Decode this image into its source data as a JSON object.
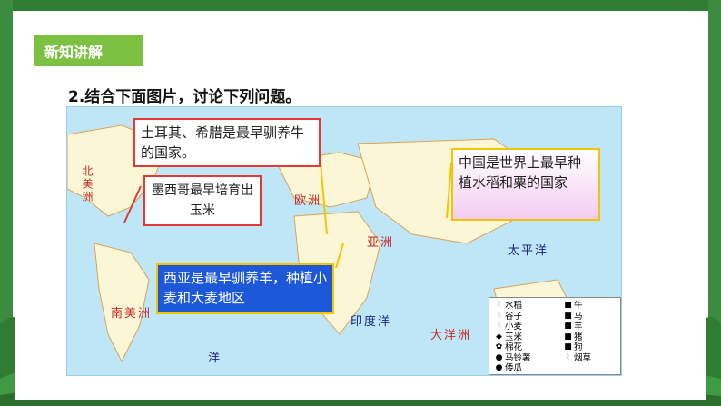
{
  "section_tag": "新知讲解",
  "question": "2.结合下面图片，讨论下列问题。",
  "continents": {
    "north_america": "北美洲",
    "europe": "欧洲",
    "asia": "亚洲",
    "south_america": "南美洲",
    "pacific": "太平洋",
    "indian": "印度洋",
    "oceania": "大洋洲",
    "bottom": "洋"
  },
  "callouts": {
    "turkey": "土耳其、希腊是最早驯养牛的国家。",
    "mexico": "墨西哥最早培育出玉米",
    "china": "中国是世界上最早种植水稻和粟的国家",
    "westasia": "西亚是最早驯养羊，种植小麦和大麦地区"
  },
  "legend": {
    "left": [
      {
        "icon": "rice-icon",
        "label": "水稻"
      },
      {
        "icon": "millet-icon",
        "label": "谷子"
      },
      {
        "icon": "wheat-icon",
        "label": "小麦"
      },
      {
        "icon": "corn-icon",
        "label": "玉米"
      },
      {
        "icon": "cotton-icon",
        "label": "棉花"
      },
      {
        "icon": "potato-icon",
        "label": "马铃薯"
      },
      {
        "icon": "sweet-potato-icon",
        "label": "倭瓜"
      }
    ],
    "right": [
      {
        "icon": "cattle-icon",
        "label": "牛"
      },
      {
        "icon": "horse-icon",
        "label": "马"
      },
      {
        "icon": "sheep-icon",
        "label": "羊"
      },
      {
        "icon": "pig-icon",
        "label": "猪"
      },
      {
        "icon": "dog-icon",
        "label": "狗"
      },
      {
        "icon": "tobacco-icon",
        "label": "烟草"
      }
    ]
  },
  "colors": {
    "ocean": "#bfe6f7",
    "land": "#fbf7d6",
    "tag_green": "#7cc142",
    "callout_red": "#e53935",
    "callout_yellow": "#f5c400",
    "callout_blue": "#1d58d8"
  }
}
